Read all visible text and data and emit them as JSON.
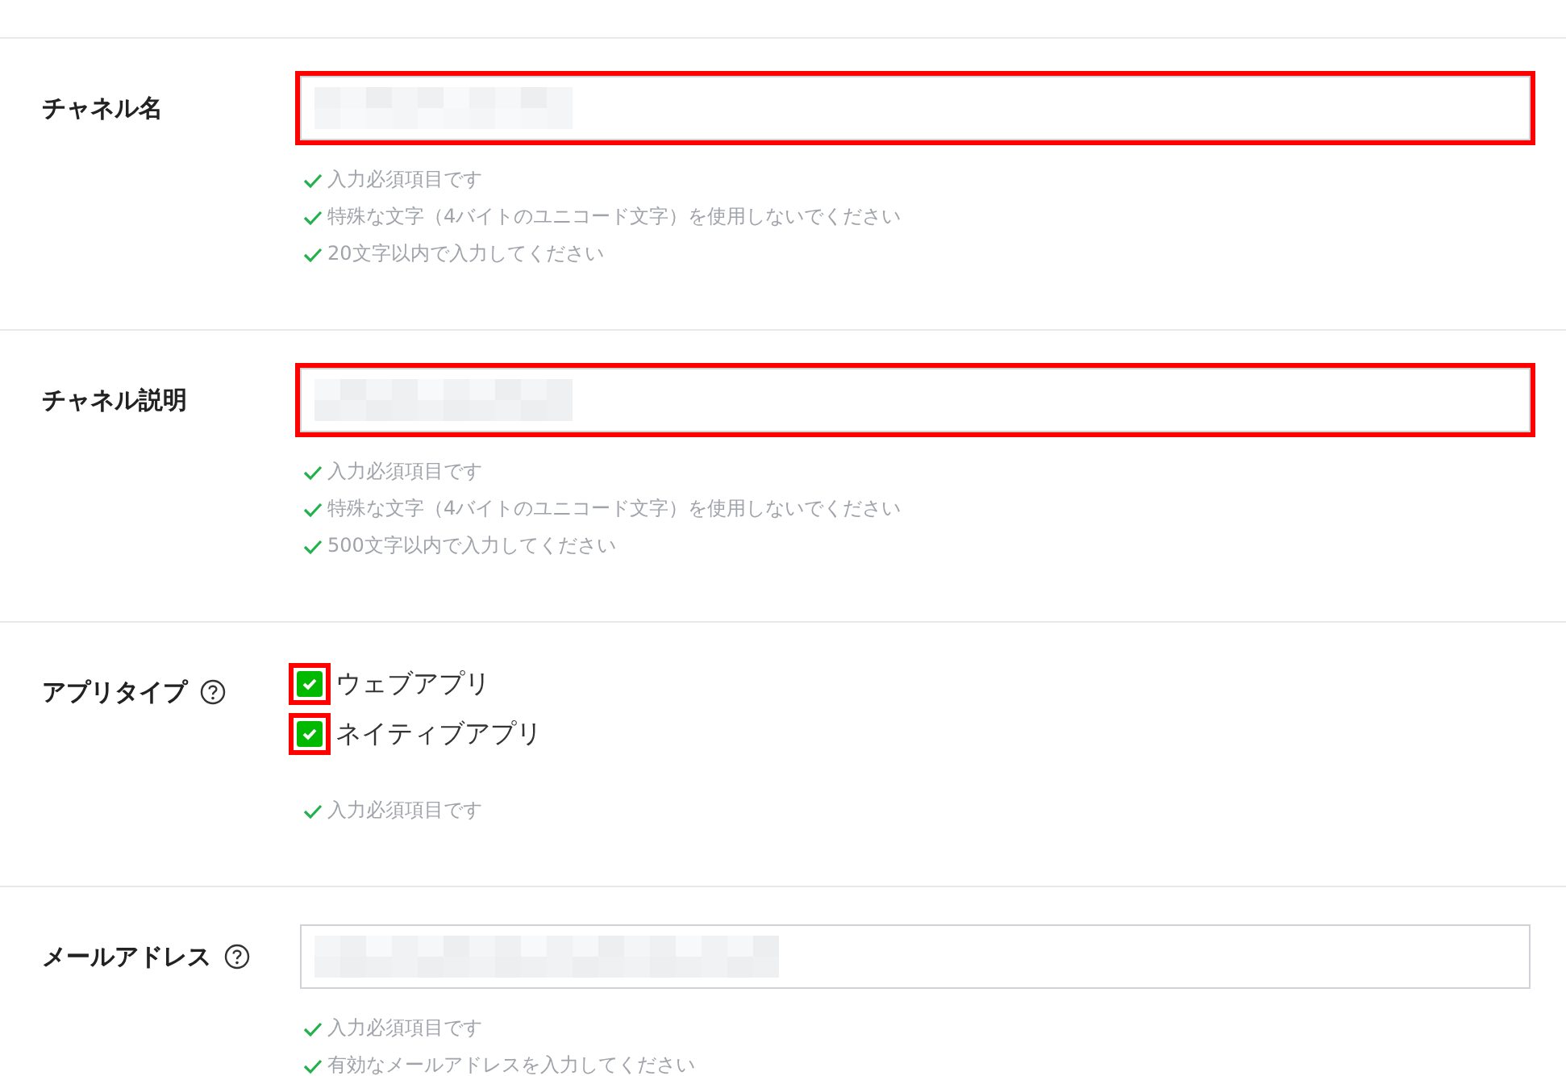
{
  "sections": [
    {
      "kind": "text",
      "label": "チャネル名",
      "help": false,
      "highlighted": true,
      "hints": [
        "入力必須項目です",
        "特殊な文字（4バイトのユニコード文字）を使用しないでください",
        "20文字以内で入力してください"
      ]
    },
    {
      "kind": "text",
      "label": "チャネル説明",
      "help": false,
      "highlighted": true,
      "hints": [
        "入力必須項目です",
        "特殊な文字（4バイトのユニコード文字）を使用しないでください",
        "500文字以内で入力してください"
      ]
    },
    {
      "kind": "checkboxes",
      "label": "アプリタイプ",
      "help": true,
      "options": [
        {
          "label": "ウェブアプリ",
          "checked": true,
          "highlighted": true
        },
        {
          "label": "ネイティブアプリ",
          "checked": true,
          "highlighted": true
        }
      ],
      "hints": [
        "入力必須項目です"
      ]
    },
    {
      "kind": "text",
      "label": "メールアドレス",
      "help": true,
      "highlighted": false,
      "hints": [
        "入力必須項目です",
        "有効なメールアドレスを入力してください"
      ]
    }
  ]
}
